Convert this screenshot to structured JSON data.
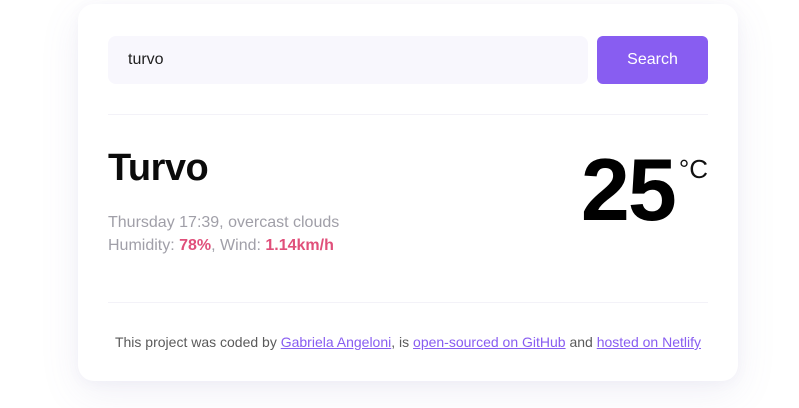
{
  "search": {
    "input_value": "turvo",
    "button_label": "Search"
  },
  "weather": {
    "city": "Turvo",
    "date_line": "Thursday 17:39, overcast clouds",
    "humidity_label": "Humidity: ",
    "humidity_value": "78%",
    "wind_label": ", Wind: ",
    "wind_value": "1.14km/h",
    "temperature": "25",
    "unit": "°C"
  },
  "footer": {
    "prefix": "This project was coded by ",
    "author_link": "Gabriela Angeloni",
    "middle": ", is ",
    "github_link": "open-sourced on GitHub",
    "and": " and ",
    "netlify_link": "hosted on Netlify"
  },
  "colors": {
    "accent": "#885df1",
    "highlight": "#e04f7a",
    "input_bg": "#f8f7fd"
  }
}
